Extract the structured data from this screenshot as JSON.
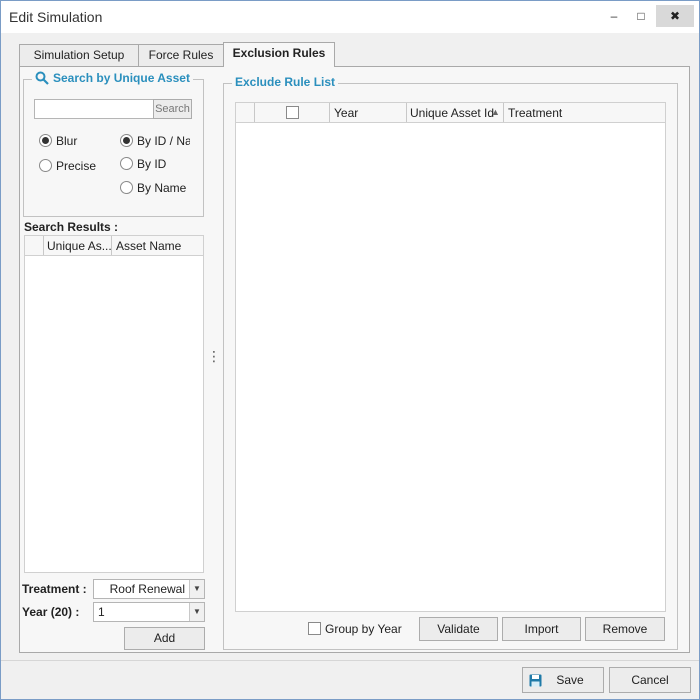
{
  "window": {
    "title": "Edit Simulation",
    "minimize_glyph": "–",
    "maximize_glyph": "□",
    "close_glyph": "✖"
  },
  "tabs": [
    {
      "label": "Simulation Setup"
    },
    {
      "label": "Force Rules"
    },
    {
      "label": "Exclusion Rules"
    }
  ],
  "search_group": {
    "title": "Search by Unique Asset",
    "search_input_value": "",
    "search_button": "Search",
    "radios_mode": [
      {
        "label": "Blur",
        "checked": true
      },
      {
        "label": "Precise",
        "checked": false
      }
    ],
    "radios_by": [
      {
        "label": "By ID / Nar",
        "checked": true
      },
      {
        "label": "By ID",
        "checked": false
      },
      {
        "label": "By Name",
        "checked": false
      }
    ]
  },
  "search_results": {
    "label": "Search Results :",
    "columns": [
      "Unique As...",
      "Asset Name"
    ]
  },
  "treatment": {
    "label": "Treatment :",
    "value": "Roof Renewal"
  },
  "year": {
    "label": "Year (20) :",
    "value": "1"
  },
  "add_button": "Add",
  "exclude_list": {
    "title": "Exclude Rule List",
    "columns": [
      "Year",
      "Unique Asset Id",
      "Treatment"
    ],
    "sort_glyph": "▲",
    "group_by_year": "Group by Year",
    "validate": "Validate",
    "import": "Import",
    "remove": "Remove"
  },
  "splitter_glyph": "⋮",
  "footer": {
    "save": "Save",
    "cancel": "Cancel"
  },
  "colors": {
    "accent": "#2a8fbd",
    "save_icon": "#1f7aa8"
  },
  "icons": {
    "search": "magnifier-icon",
    "save": "floppy-disk-icon"
  }
}
